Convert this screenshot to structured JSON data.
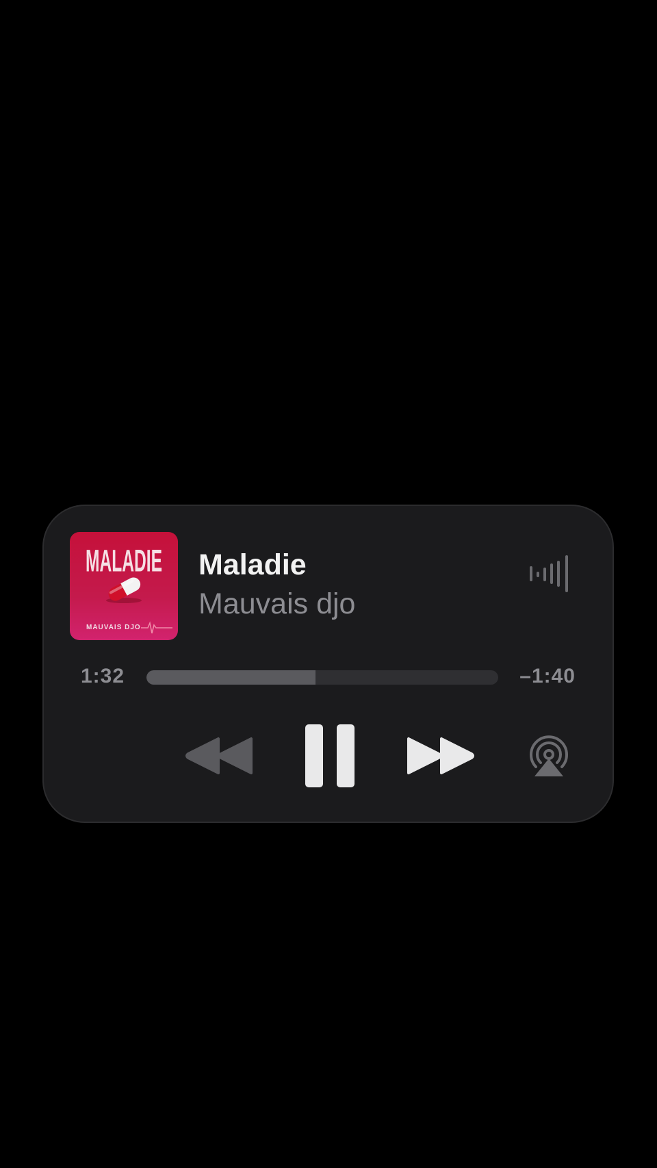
{
  "now_playing": {
    "title": "Maladie",
    "artist": "Mauvais djo",
    "artwork": {
      "title_text": "MALADIE",
      "artist_text": "MAUVAIS DJO",
      "background_color": "#c2143f"
    }
  },
  "progress": {
    "elapsed": "1:32",
    "remaining": "–1:40",
    "fraction": 0.48
  },
  "controls": {
    "rewind_icon": "backward-icon",
    "pause_icon": "pause-icon",
    "forward_icon": "forward-icon",
    "airplay_icon": "airplay-icon",
    "waveform_icon": "waveform-icon"
  },
  "colors": {
    "background": "#000000",
    "card": "#1b1b1d",
    "title": "#f2f2f2",
    "secondary_text": "#8d8d92",
    "active_control": "#e9e9ea",
    "dimmed_control": "#5a5a5e"
  }
}
